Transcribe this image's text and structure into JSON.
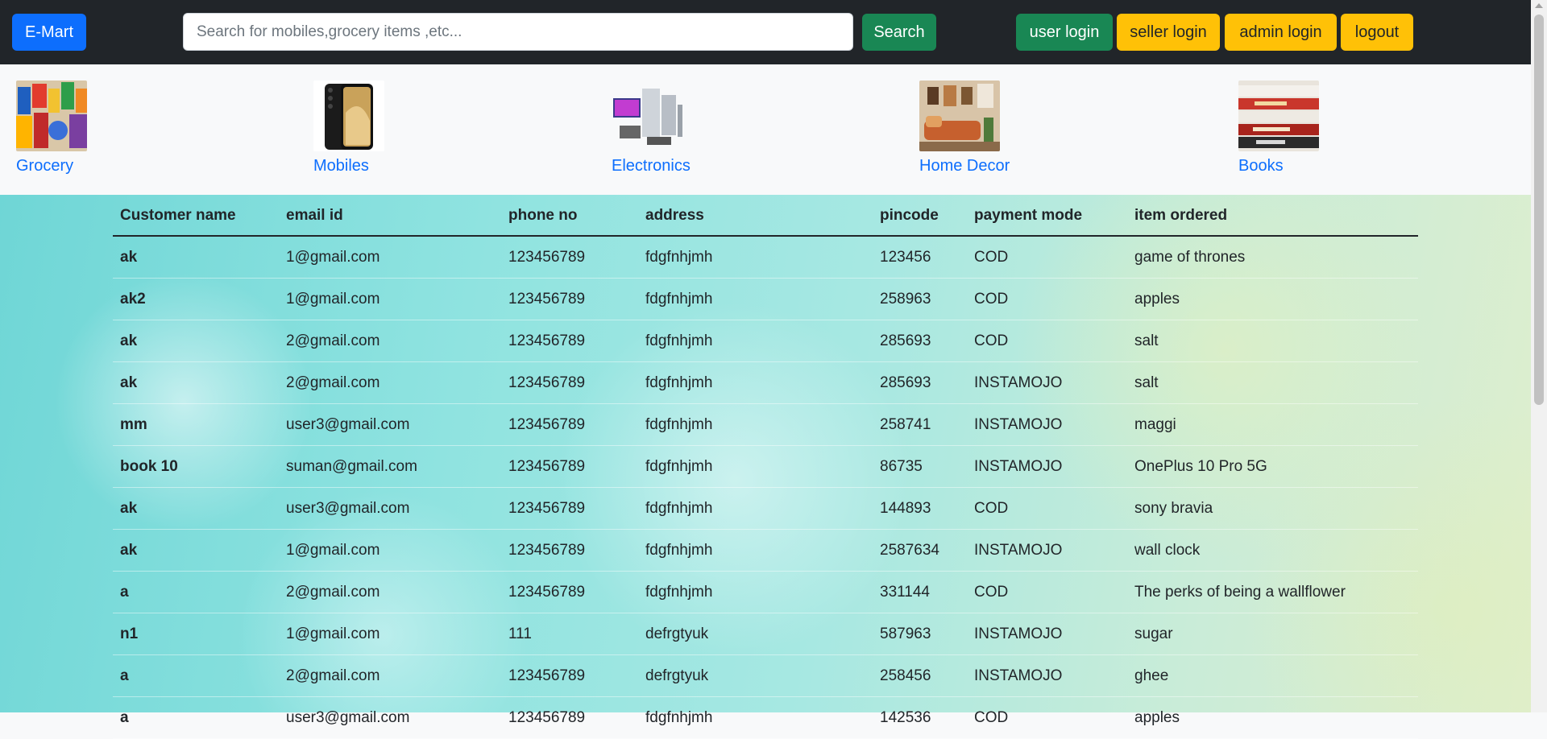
{
  "navbar": {
    "brand": "E-Mart",
    "search_placeholder": "Search for mobiles,grocery items ,etc...",
    "search_label": "Search",
    "user_login": "user login",
    "seller_login": "seller login",
    "admin_login": "admin login",
    "logout": "logout"
  },
  "categories": [
    {
      "label": "Grocery",
      "icon": "grocery-image"
    },
    {
      "label": "Mobiles",
      "icon": "mobile-image"
    },
    {
      "label": "Electronics",
      "icon": "electronics-image"
    },
    {
      "label": "Home Decor",
      "icon": "home-decor-image"
    },
    {
      "label": "Books",
      "icon": "books-image"
    }
  ],
  "table": {
    "headers": [
      "Customer name",
      "email id",
      "phone no",
      "address",
      "pincode",
      "payment mode",
      "item ordered"
    ],
    "rows": [
      [
        "ak",
        "1@gmail.com",
        "123456789",
        "fdgfnhjmh",
        "123456",
        "COD",
        "game of thrones"
      ],
      [
        "ak2",
        "1@gmail.com",
        "123456789",
        "fdgfnhjmh",
        "258963",
        "COD",
        "apples"
      ],
      [
        "ak",
        "2@gmail.com",
        "123456789",
        "fdgfnhjmh",
        "285693",
        "COD",
        "salt"
      ],
      [
        "ak",
        "2@gmail.com",
        "123456789",
        "fdgfnhjmh",
        "285693",
        "INSTAMOJO",
        "salt"
      ],
      [
        "mm",
        "user3@gmail.com",
        "123456789",
        "fdgfnhjmh",
        "258741",
        "INSTAMOJO",
        "maggi"
      ],
      [
        "book 10",
        "suman@gmail.com",
        "123456789",
        "fdgfnhjmh",
        "86735",
        "INSTAMOJO",
        "OnePlus 10 Pro 5G"
      ],
      [
        "ak",
        "user3@gmail.com",
        "123456789",
        "fdgfnhjmh",
        "144893",
        "COD",
        "sony bravia"
      ],
      [
        "ak",
        "1@gmail.com",
        "123456789",
        "fdgfnhjmh",
        "2587634",
        "INSTAMOJO",
        "wall clock"
      ],
      [
        "a",
        "2@gmail.com",
        "123456789",
        "fdgfnhjmh",
        "331144",
        "COD",
        "The perks of being a wallflower"
      ],
      [
        "n1",
        "1@gmail.com",
        "111",
        "defrgtyuk",
        "587963",
        "INSTAMOJO",
        "sugar"
      ],
      [
        "a",
        "2@gmail.com",
        "123456789",
        "defrgtyuk",
        "258456",
        "INSTAMOJO",
        "ghee"
      ],
      [
        "a",
        "user3@gmail.com",
        "123456789",
        "fdgfnhjmh",
        "142536",
        "COD",
        "apples"
      ]
    ]
  },
  "colors": {
    "navbar": "#212529",
    "brand": "#0d6efd",
    "green": "#198754",
    "yellow": "#ffc107",
    "link": "#0d6efd"
  }
}
